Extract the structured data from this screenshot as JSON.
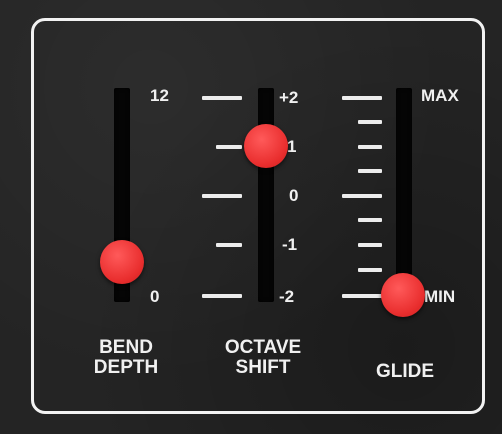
{
  "bend_depth": {
    "scale_top": "12",
    "scale_bottom": "0",
    "title_line1": "BEND",
    "title_line2": "DEPTH",
    "value_fraction": 0.2
  },
  "octave_shift": {
    "scale": [
      "+2",
      "1",
      "0",
      "-1",
      "-2"
    ],
    "title_line1": "OCTAVE",
    "title_line2": "SHIFT",
    "value": 1
  },
  "glide": {
    "scale_top": "MAX",
    "scale_bottom": "MIN",
    "title": "GLIDE",
    "value_fraction": 0.0
  },
  "colors": {
    "knob": "#e92e2e",
    "frame": "#f2f2f2",
    "background": "#242424"
  }
}
